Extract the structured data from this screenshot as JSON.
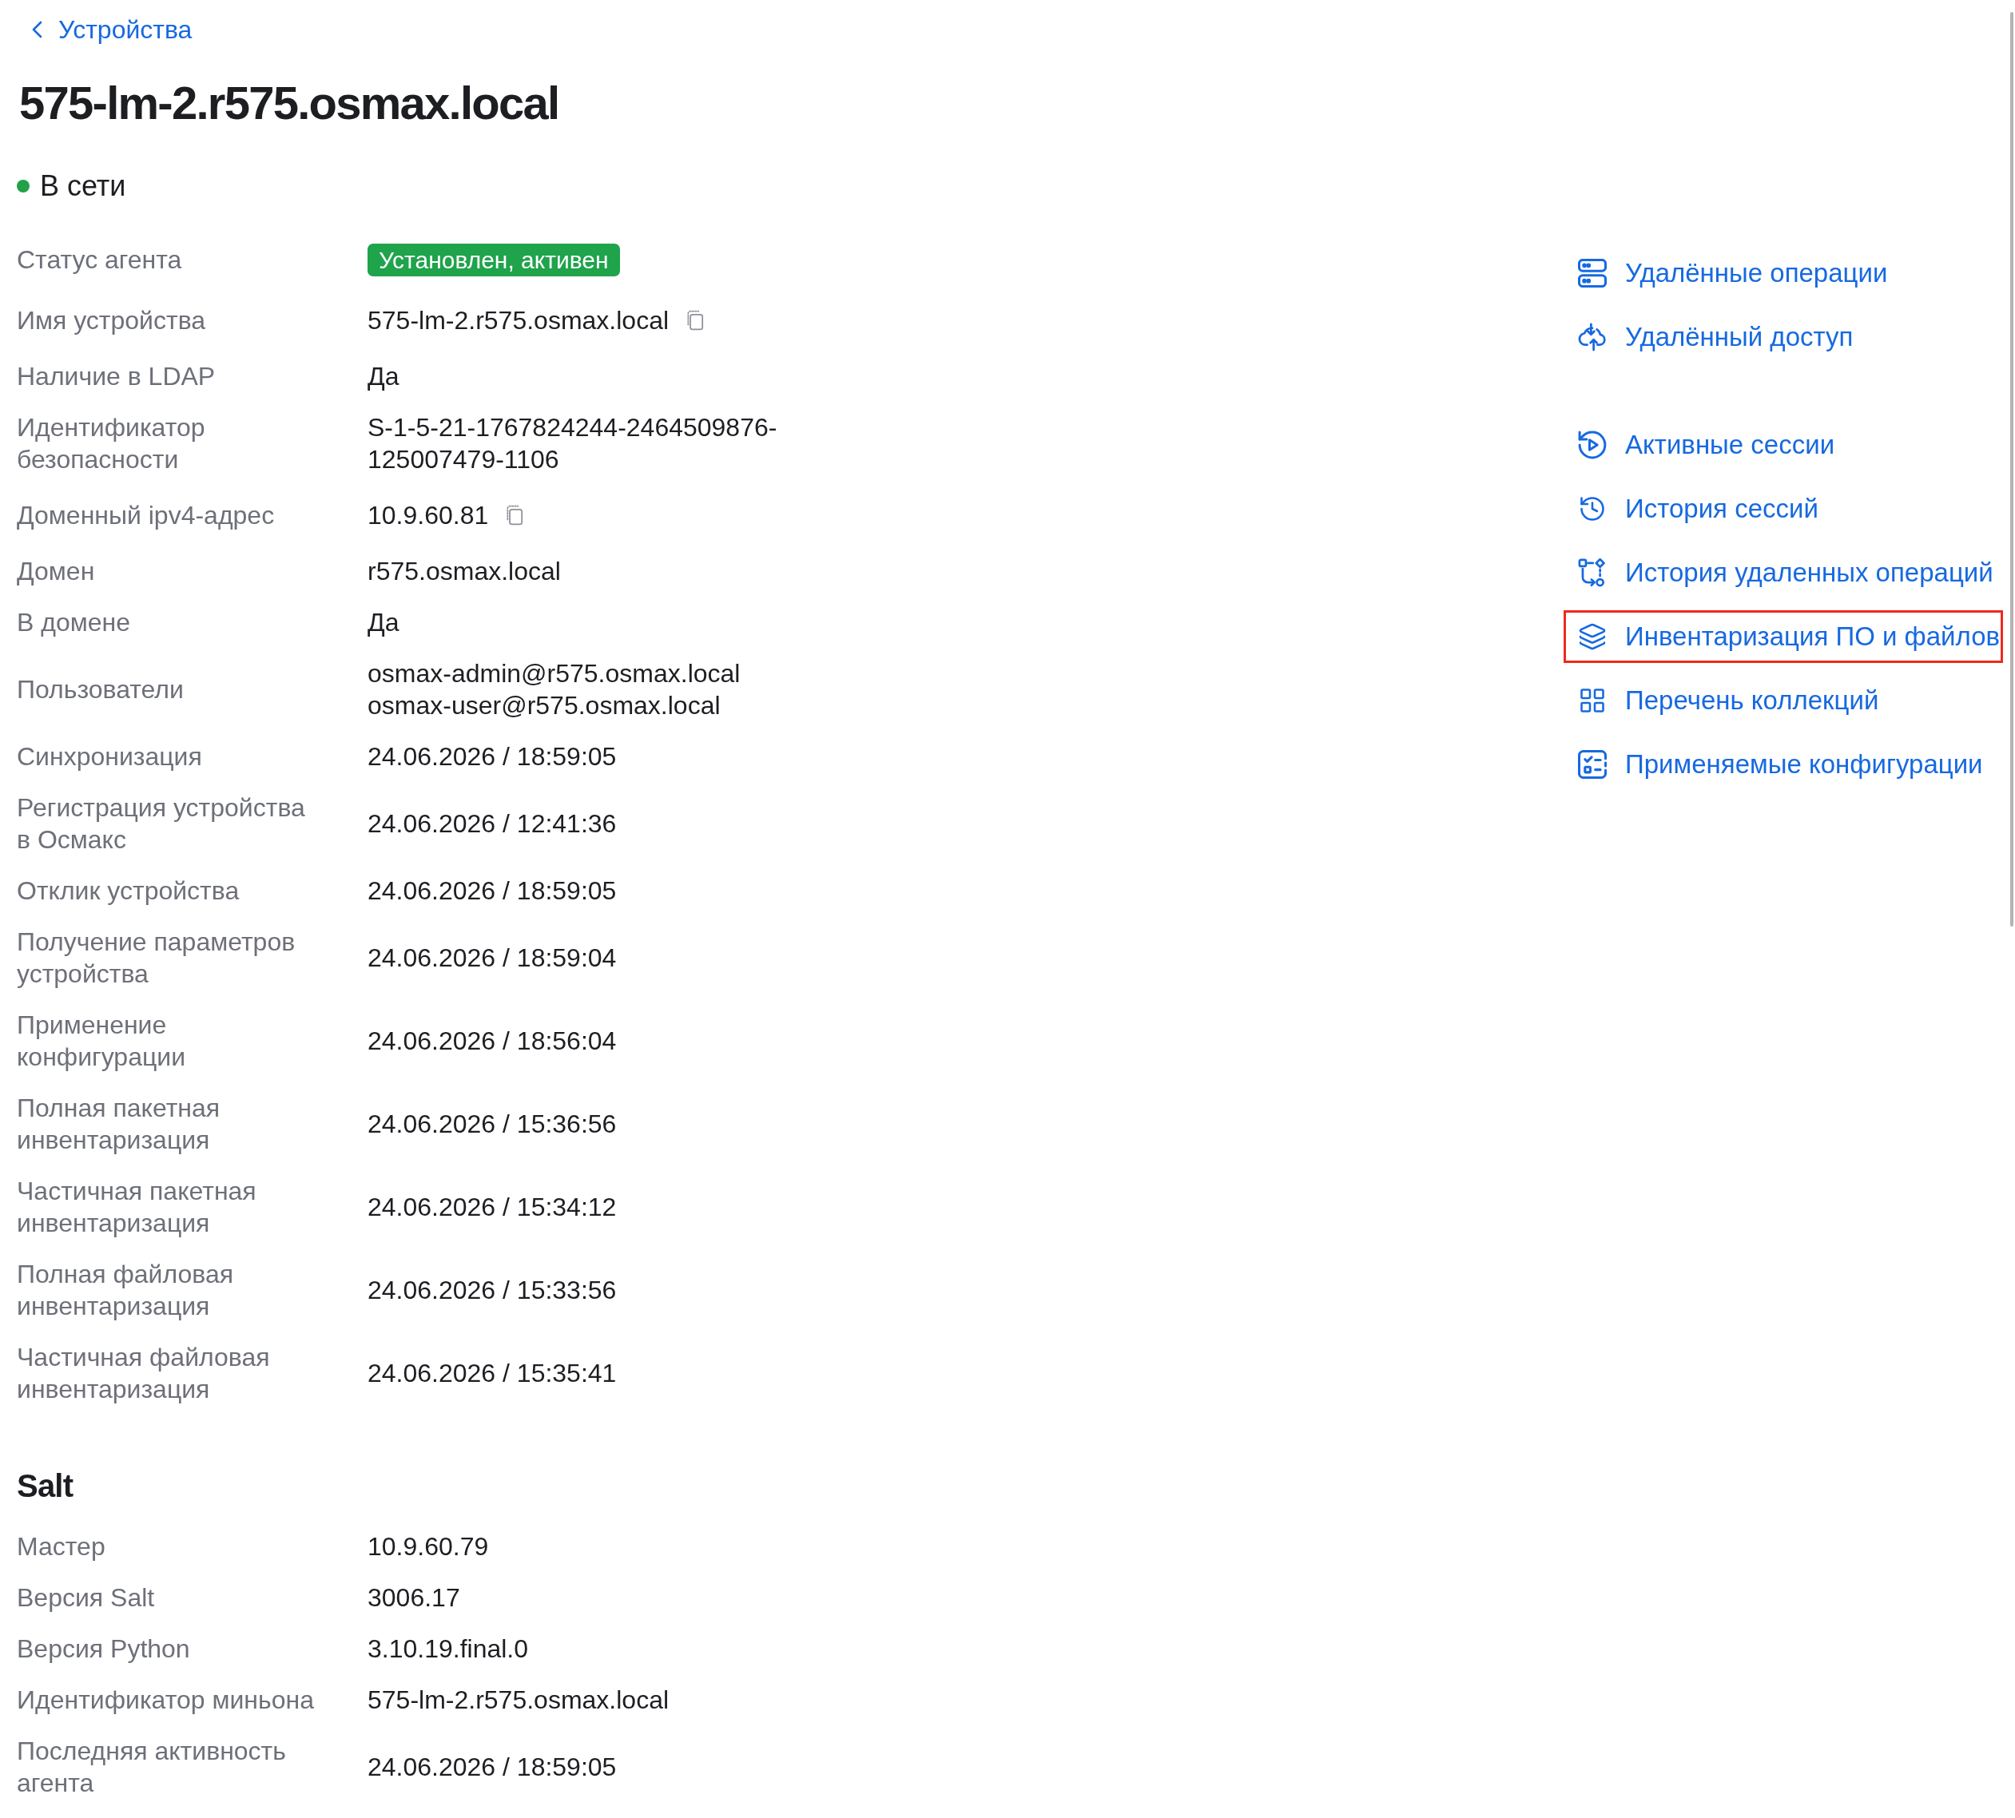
{
  "back_link": {
    "label": "Устройства"
  },
  "title": "575-lm-2.r575.osmax.local",
  "status": {
    "label": "В сети",
    "online": true
  },
  "details": [
    {
      "label": "Статус агента",
      "kind": "badge",
      "value": "Установлен, активен"
    },
    {
      "label": "Имя устройства",
      "kind": "copy",
      "value": "575-lm-2.r575.osmax.local"
    },
    {
      "label": "Наличие в LDAP",
      "kind": "text",
      "value": "Да"
    },
    {
      "label": "Идентификатор безопасности",
      "kind": "text",
      "value": "S-1-5-21-1767824244-2464509876-125007479-1106"
    },
    {
      "label": "Доменный ipv4-адрес",
      "kind": "copy",
      "value": "10.9.60.81"
    },
    {
      "label": "Домен",
      "kind": "text",
      "value": "r575.osmax.local"
    },
    {
      "label": "В домене",
      "kind": "text",
      "value": "Да"
    },
    {
      "label": "Пользователи",
      "kind": "list",
      "values": [
        "osmax-admin@r575.osmax.local",
        "osmax-user@r575.osmax.local"
      ]
    },
    {
      "label": "Синхронизация",
      "kind": "text",
      "value": "24.06.2026 / 18:59:05"
    },
    {
      "label": "Регистрация устройства в Осмакс",
      "kind": "text",
      "value": "24.06.2026 / 12:41:36"
    },
    {
      "label": "Отклик устройства",
      "kind": "text",
      "value": "24.06.2026 / 18:59:05"
    },
    {
      "label": "Получение параметров устройства",
      "kind": "text",
      "value": "24.06.2026 / 18:59:04"
    },
    {
      "label": "Применение конфигурации",
      "kind": "text",
      "value": "24.06.2026 / 18:56:04"
    },
    {
      "label": "Полная пакетная инвентаризация",
      "kind": "text",
      "value": "24.06.2026 / 15:36:56"
    },
    {
      "label": "Частичная пакетная инвентаризация",
      "kind": "text",
      "value": "24.06.2026 / 15:34:12"
    },
    {
      "label": "Полная файловая инвентаризация",
      "kind": "text",
      "value": "24.06.2026 / 15:33:56"
    },
    {
      "label": "Частичная файловая инвентаризация",
      "kind": "text",
      "value": "24.06.2026 / 15:35:41"
    }
  ],
  "salt": {
    "title": "Salt",
    "rows": [
      {
        "label": "Мастер",
        "kind": "text",
        "value": "10.9.60.79"
      },
      {
        "label": "Версия Salt",
        "kind": "text",
        "value": "3006.17"
      },
      {
        "label": "Версия Python",
        "kind": "text",
        "value": "3.10.19.final.0"
      },
      {
        "label": "Идентификатор миньона",
        "kind": "text",
        "value": "575-lm-2.r575.osmax.local"
      },
      {
        "label": "Последняя активность агента",
        "kind": "text",
        "value": "24.06.2026 / 18:59:05"
      }
    ]
  },
  "actions": [
    {
      "items": [
        {
          "label": "Удалённые операции",
          "highlighted": false
        },
        {
          "label": "Удалённый доступ",
          "highlighted": false
        }
      ]
    },
    {
      "items": [
        {
          "label": "Активные сессии",
          "highlighted": false
        },
        {
          "label": "История сессий",
          "highlighted": false
        },
        {
          "label": "История удаленных операций",
          "highlighted": false
        },
        {
          "label": "Инвентаризация ПО и файлов",
          "highlighted": true
        },
        {
          "label": "Перечень коллекций",
          "highlighted": false
        },
        {
          "label": "Применяемые конфигурации",
          "highlighted": false
        }
      ]
    }
  ]
}
